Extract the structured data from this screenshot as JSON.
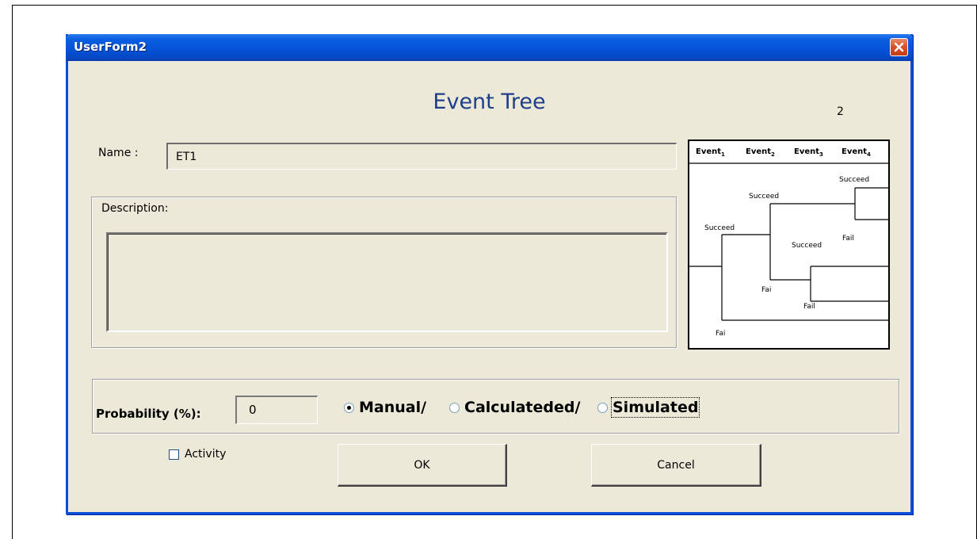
{
  "window": {
    "title": "UserForm2",
    "colors": {
      "titlebar": "#0553d8",
      "face": "#ece9d8",
      "close_button": "#d8502c"
    }
  },
  "form": {
    "title": "Event Tree",
    "page_number": "2"
  },
  "name": {
    "label": "Name :",
    "value": "ET1"
  },
  "description": {
    "label": "Description:",
    "value": ""
  },
  "tree_diagram": {
    "events": [
      {
        "text": "Event",
        "sub": "1"
      },
      {
        "text": "Event",
        "sub": "2"
      },
      {
        "text": "Event",
        "sub": "3"
      },
      {
        "text": "Event",
        "sub": "4"
      }
    ],
    "labels": {
      "succeed_1": "Succeed",
      "fail_1": "Fai",
      "succeed_2": "Succeed",
      "fail_2": "Fai",
      "succeed_3a": "Succeed",
      "fail_3a": "Fail",
      "succeed_3b": "Succeed",
      "fail_3b": "Fail"
    }
  },
  "probability": {
    "label": "Probability (%):",
    "value": "0",
    "options": [
      {
        "label": "Manual/",
        "checked": true
      },
      {
        "label": "Calculateded/",
        "checked": false
      },
      {
        "label": "Simulated",
        "checked": false
      }
    ]
  },
  "activity": {
    "label": "Activity",
    "checked": false
  },
  "buttons": {
    "ok": "OK",
    "cancel": "Cancel"
  }
}
